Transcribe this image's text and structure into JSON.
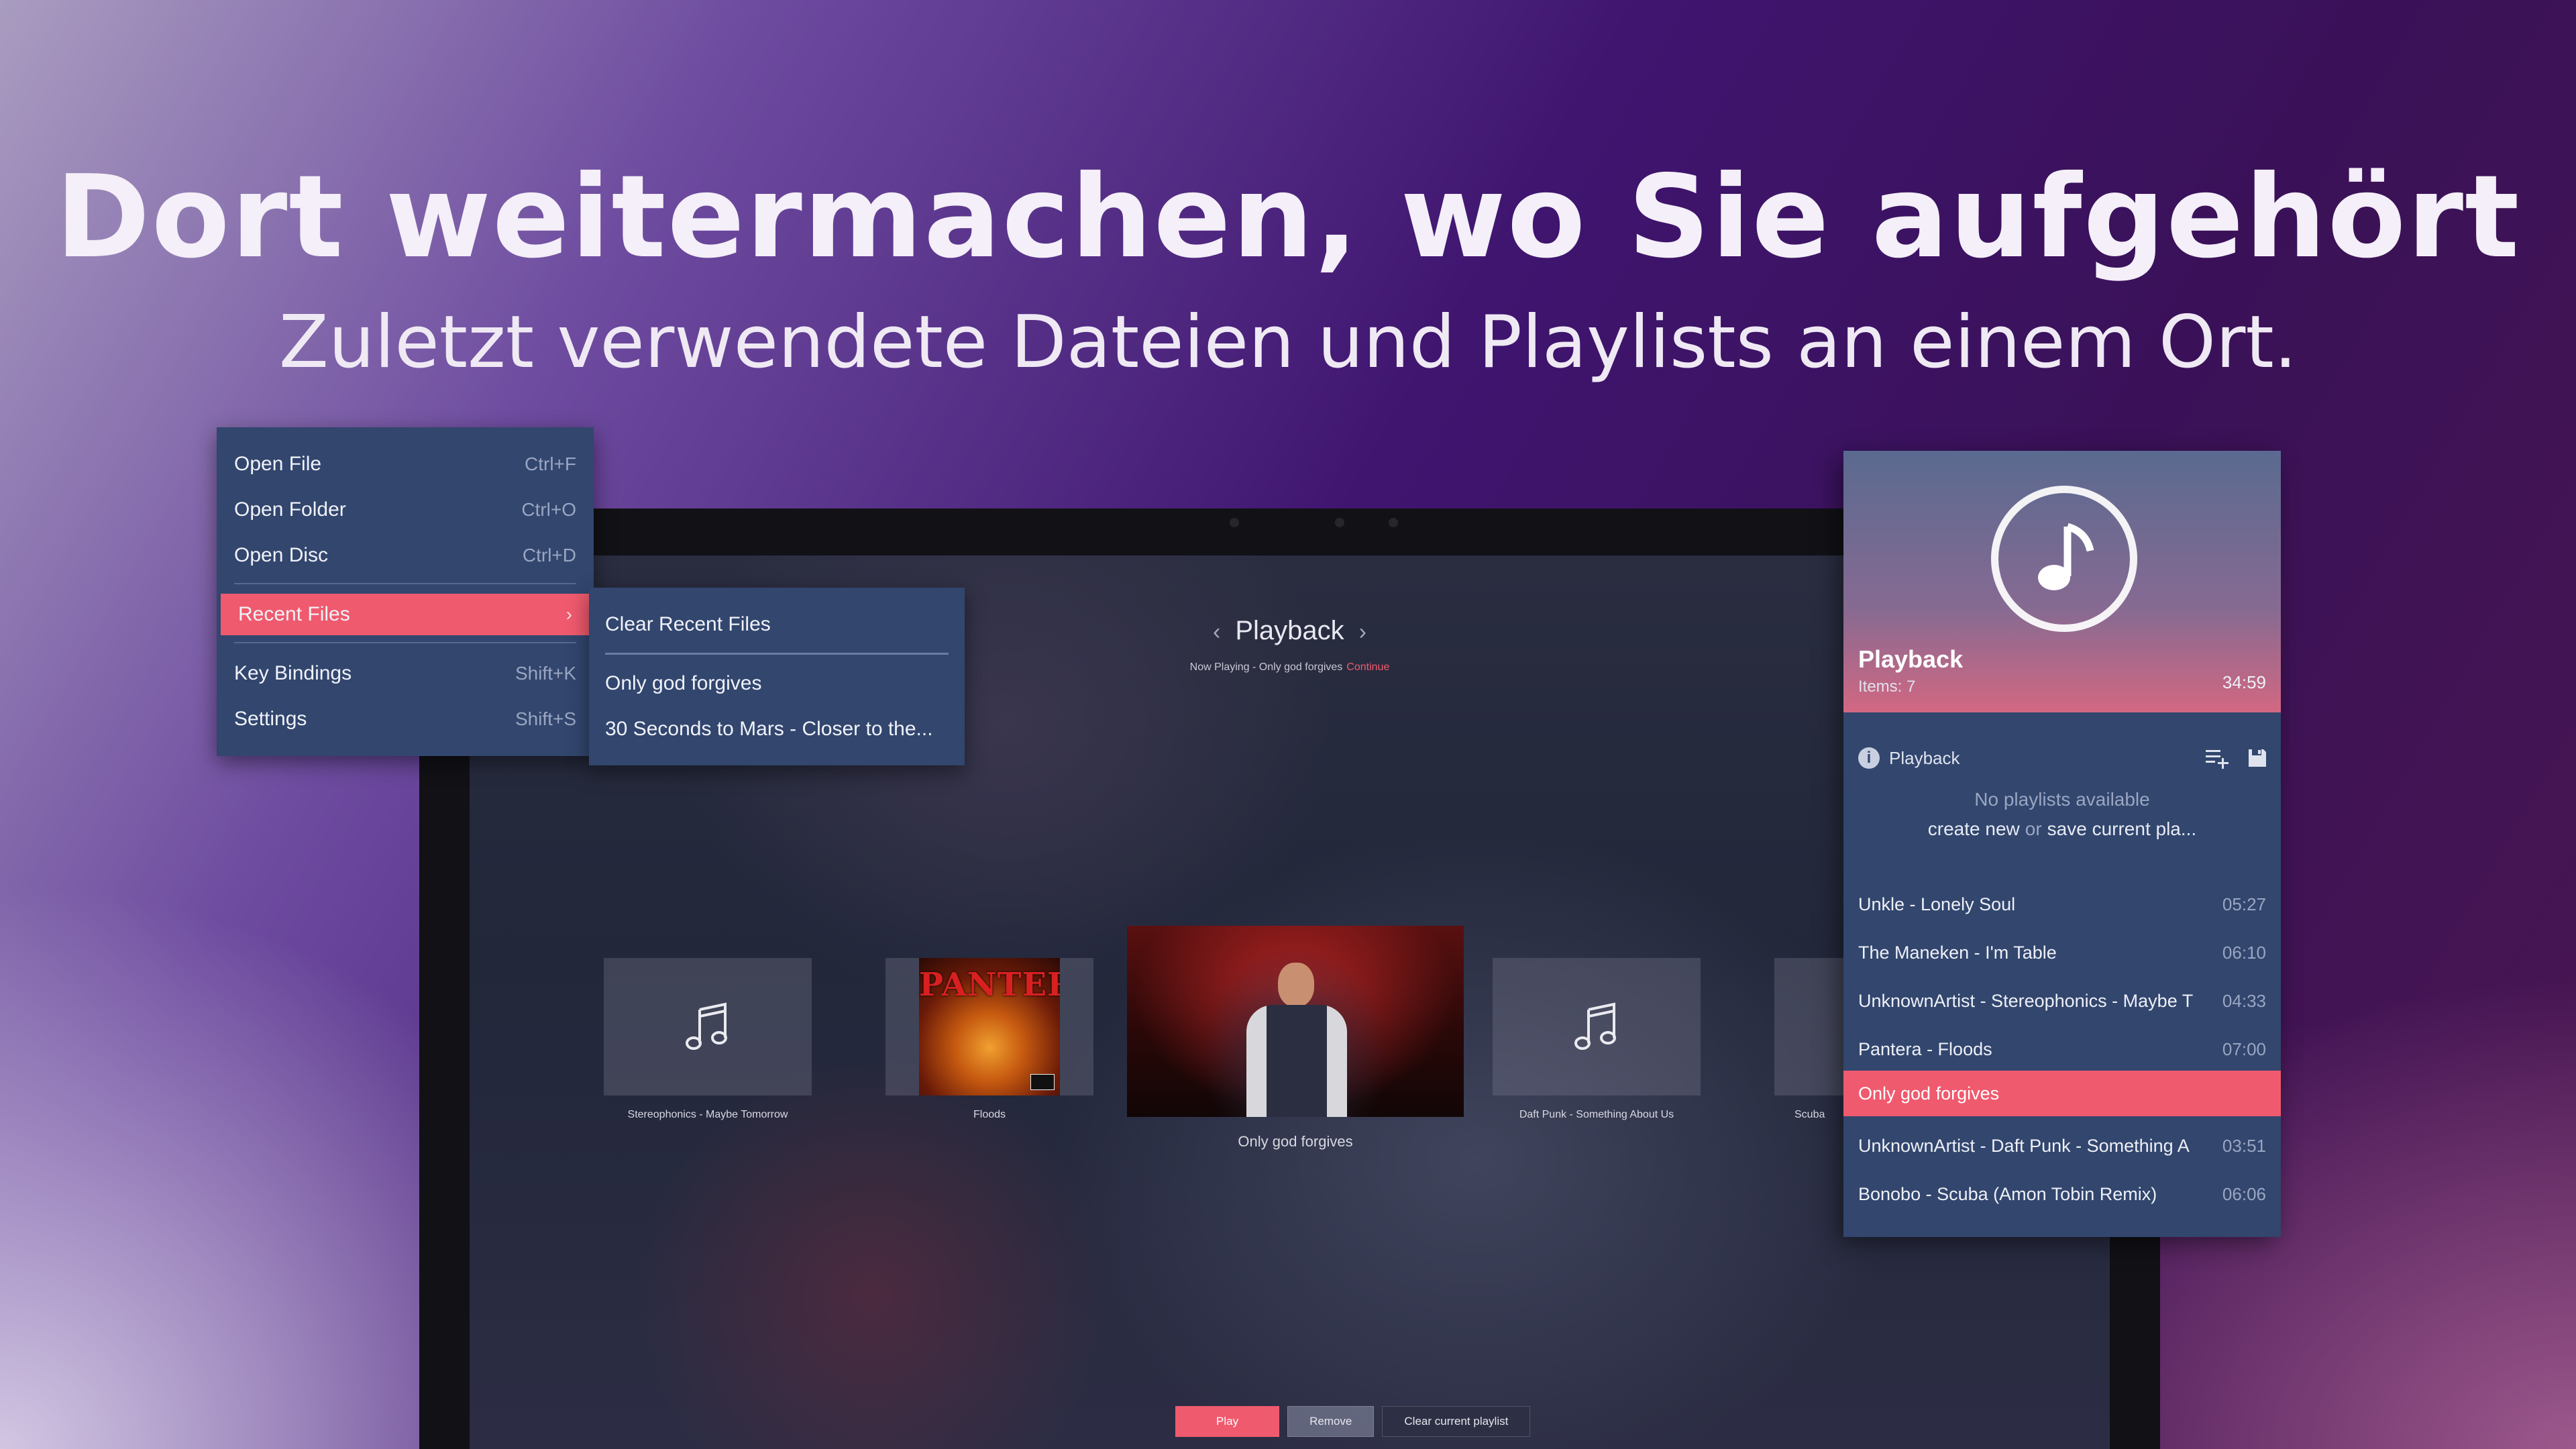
{
  "hero": {
    "title": "Dort weitermachen, wo Sie aufgehört",
    "subtitle": "Zuletzt verwendete Dateien und Playlists an einem Ort."
  },
  "colors": {
    "accent": "#f05a6e",
    "panel": "#32466e"
  },
  "player": {
    "title": "Playback",
    "now_playing": "Now Playing - Only god forgives",
    "continue_label": "Continue",
    "cards": [
      {
        "caption": "Stereophonics - Maybe Tomorrow",
        "icon": "music-note-icon"
      },
      {
        "caption": "Floods",
        "art_text": "PANTERA"
      },
      {
        "caption": "Only god forgives"
      },
      {
        "caption": "Daft Punk - Something About Us",
        "icon": "music-note-icon"
      },
      {
        "caption": "Scuba"
      }
    ],
    "buttons": {
      "play": "Play",
      "remove": "Remove",
      "clear": "Clear current playlist"
    }
  },
  "menu": {
    "items": [
      {
        "label": "Open File",
        "shortcut": "Ctrl+F"
      },
      {
        "label": "Open Folder",
        "shortcut": "Ctrl+O"
      },
      {
        "label": "Open Disc",
        "shortcut": "Ctrl+D"
      },
      {
        "label": "Recent Files",
        "shortcut": "›"
      },
      {
        "label": "Key Bindings",
        "shortcut": "Shift+K"
      },
      {
        "label": "Settings",
        "shortcut": "Shift+S"
      }
    ],
    "recent": {
      "clear_label": "Clear Recent Files",
      "files": [
        "Only god forgives",
        "30 Seconds to Mars - Closer to the..."
      ]
    }
  },
  "playlist": {
    "title": "Playback",
    "items_label": "Items: 7",
    "duration": "34:59",
    "name": "Playback",
    "empty_text": "No playlists available",
    "create_label": "create new",
    "or_label": "or",
    "save_label": "save current pla...",
    "tracks": [
      {
        "title": "Unkle - Lonely Soul",
        "duration": "05:27"
      },
      {
        "title": "The Maneken - I'm Table",
        "duration": "06:10"
      },
      {
        "title": "UnknownArtist - Stereophonics - Maybe T",
        "duration": "04:33"
      },
      {
        "title": "Pantera - Floods",
        "duration": "07:00"
      },
      {
        "title": "Only god forgives",
        "duration": ""
      },
      {
        "title": "UnknownArtist - Daft Punk - Something A",
        "duration": "03:51"
      },
      {
        "title": "Bonobo - Scuba (Amon Tobin Remix)",
        "duration": "06:06"
      }
    ]
  }
}
